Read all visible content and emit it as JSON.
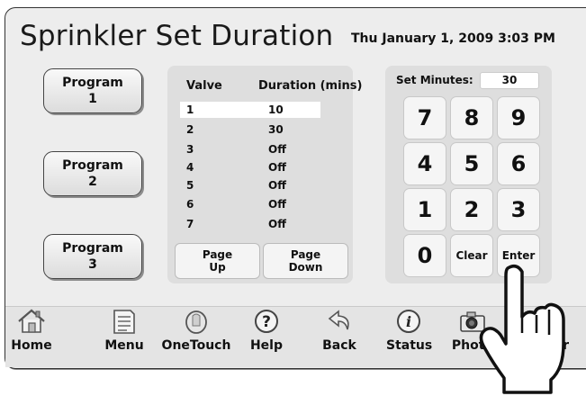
{
  "header": {
    "title": "Sprinkler Set Duration",
    "datetime": "Thu January 1, 2009  3:03 PM"
  },
  "programs": [
    {
      "line1": "Program",
      "line2": "1"
    },
    {
      "line1": "Program",
      "line2": "2"
    },
    {
      "line1": "Program",
      "line2": "3"
    }
  ],
  "table": {
    "col_valve": "Valve",
    "col_duration": "Duration (mins)",
    "rows": [
      {
        "valve": "1",
        "duration": "10"
      },
      {
        "valve": "2",
        "duration": "30"
      },
      {
        "valve": "3",
        "duration": "Off"
      },
      {
        "valve": "4",
        "duration": "Off"
      },
      {
        "valve": "5",
        "duration": "Off"
      },
      {
        "valve": "6",
        "duration": "Off"
      },
      {
        "valve": "7",
        "duration": "Off"
      }
    ],
    "page_up": {
      "line1": "Page",
      "line2": "Up"
    },
    "page_down": {
      "line1": "Page",
      "line2": "Down"
    }
  },
  "keypad": {
    "label": "Set Minutes:",
    "value": "30",
    "keys": [
      "7",
      "8",
      "9",
      "4",
      "5",
      "6",
      "1",
      "2",
      "3",
      "0",
      "Clear",
      "Enter"
    ]
  },
  "toolbar": {
    "home": "Home",
    "menu": "Menu",
    "onetouch": "OneTouch",
    "help": "Help",
    "back": "Back",
    "status": "Status",
    "photo": "Photo",
    "last_fragment": "r"
  }
}
